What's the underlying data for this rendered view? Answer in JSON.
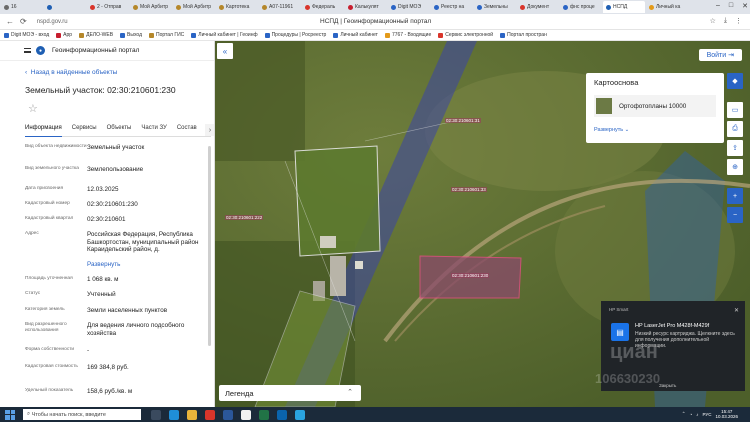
{
  "browser": {
    "tabs": [
      {
        "label": "16",
        "color": "#6a6a6a"
      },
      {
        "label": "",
        "color": "#1f5fb3"
      },
      {
        "label": "2 - Отправ",
        "color": "#d9352b"
      },
      {
        "label": "Мой Арбитр",
        "color": "#b5872a"
      },
      {
        "label": "Мой Арбитр",
        "color": "#b5872a"
      },
      {
        "label": "Картотека",
        "color": "#b5872a"
      },
      {
        "label": "А07-11961",
        "color": "#b5872a"
      },
      {
        "label": "Федераль",
        "color": "#d9352b"
      },
      {
        "label": "Калькулят",
        "color": "#c71e2f"
      },
      {
        "label": "Digit МОЭ",
        "color": "#2a64c5"
      },
      {
        "label": "Реестр на",
        "color": "#2a64c5"
      },
      {
        "label": "Земельны",
        "color": "#2a64c5"
      },
      {
        "label": "Документ",
        "color": "#d9352b"
      },
      {
        "label": "фнс проце",
        "color": "#2a64c5"
      },
      {
        "label": "НСПД",
        "color": "#1f5fb3"
      },
      {
        "label": "Личный ка",
        "color": "#e39a1a"
      }
    ],
    "address": "nspd.gov.ru",
    "window_title": "НСПД | Геоинформационный портал",
    "bookmarks": [
      {
        "label": "Digit МОЭ - вход",
        "color": "#2a64c5"
      },
      {
        "label": "App",
        "color": "#c71e2f"
      },
      {
        "label": "ДЕЛО-WEB",
        "color": "#b5872a"
      },
      {
        "label": "Выход",
        "color": "#2a64c5"
      },
      {
        "label": "Портал ГИС",
        "color": "#b5872a"
      },
      {
        "label": "Личный кабинет | Геоинф",
        "color": "#2a64c5"
      },
      {
        "label": "Процедуры | Росреестр",
        "color": "#2a64c5"
      },
      {
        "label": "Личный кабинет",
        "color": "#2a64c5"
      },
      {
        "label": "7767 - Входящие",
        "color": "#e39a1a"
      },
      {
        "label": "Сервис электронной",
        "color": "#d9352b"
      },
      {
        "label": "Портал простран",
        "color": "#2a64c5"
      }
    ]
  },
  "panel": {
    "portal_name": "Геоинформационный портал",
    "back_label": "Назад в найденные объекты",
    "title": "Земельный участок: 02:30:210601:230",
    "tabs": [
      "Информация",
      "Сервисы",
      "Объекты",
      "Части ЗУ",
      "Состав"
    ],
    "properties": [
      {
        "label": "Вид объекта недвижимости",
        "value": "Земельный участок"
      },
      {
        "label": "Вид земельного участка",
        "value": "Землепользование"
      },
      {
        "label": "Дата присвоения",
        "value": "12.03.2025"
      },
      {
        "label": "Кадастровый номер",
        "value": "02:30:210601:230"
      },
      {
        "label": "Кадастровый квартал",
        "value": "02:30:210601"
      },
      {
        "label": "Адрес",
        "value": "Российская Федерация, Республика Башкортостан, муниципальный район Караидельский район, д."
      },
      {
        "label": "",
        "value": "Развернуть"
      },
      {
        "label": "Площадь уточненная",
        "value": "1 068 кв. м"
      },
      {
        "label": "Статус",
        "value": "Учтенный"
      },
      {
        "label": "Категория земель",
        "value": "Земли населенных пунктов"
      },
      {
        "label": "Вид разрешенного использования",
        "value": "Для ведения личного подсобного хозяйства"
      },
      {
        "label": "Форма собственности",
        "value": "-"
      },
      {
        "label": "Кадастровая стоимость",
        "value": "169 384,8 руб."
      },
      {
        "label": "Удельный показатель",
        "value": "158,6 руб./кв. м"
      }
    ]
  },
  "map": {
    "login_label": "Войти",
    "basemap": {
      "title": "Картооснова",
      "item": "Ортофотопланы 10000",
      "more": "Развернуть"
    },
    "legend_label": "Легенда",
    "parcel_labels": [
      "02:30:210601:222",
      "02:30:210601:31",
      "02:30:210601:33",
      "02:30:210601:230"
    ]
  },
  "notification": {
    "app": "HP Smart",
    "title": "HP LaserJet Pro M428f-M429f",
    "message": "Низкий ресурс картриджа. Щелкните здесь для получения дополнительной информации.",
    "snooze": "Закрыть",
    "watermark_brand": "циан",
    "watermark_id": "106630230"
  },
  "taskbar": {
    "search_placeholder": "Чтобы начать поиск, введите",
    "lang": "РУС",
    "time": "15:47",
    "date": "10.03.2026"
  }
}
